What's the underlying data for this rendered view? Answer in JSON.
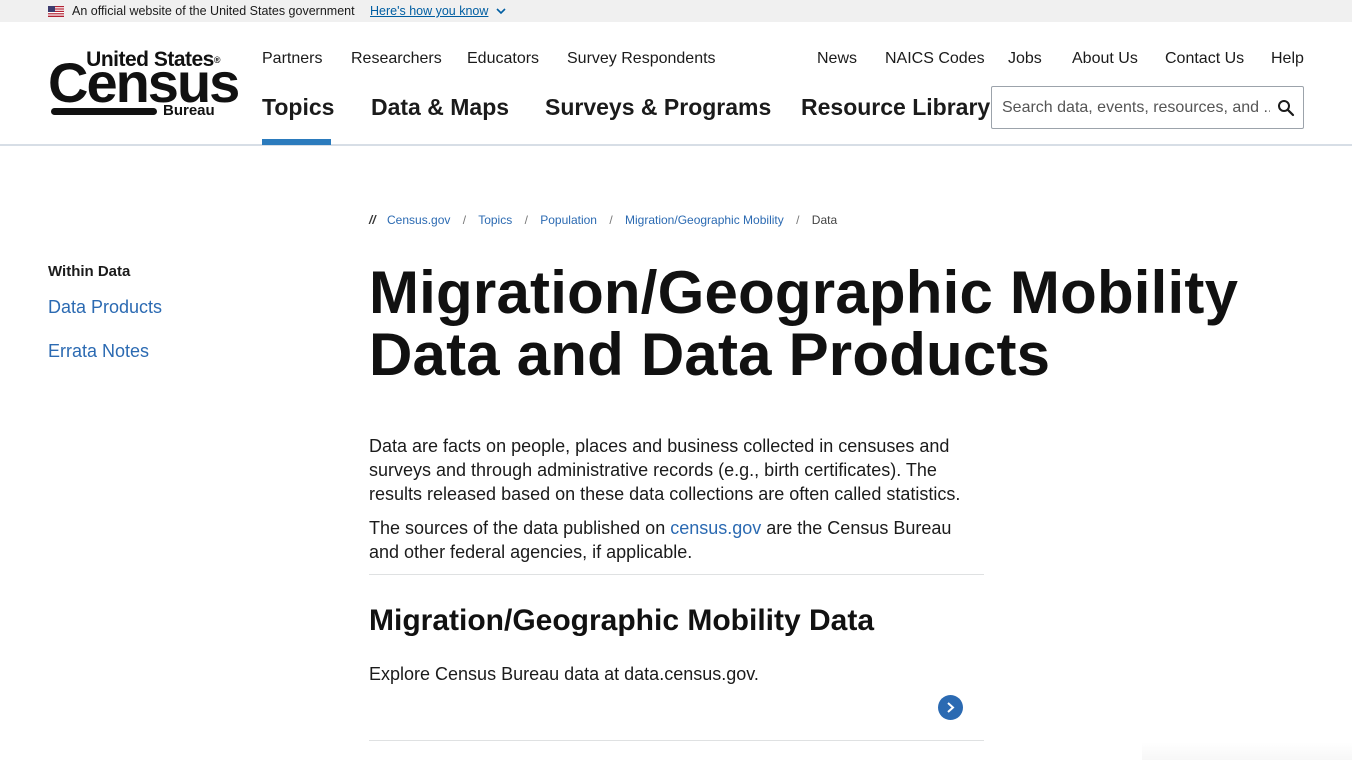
{
  "gov_banner": {
    "text": "An official website of the United States government",
    "link": "Here's how you know"
  },
  "logo": {
    "line1": "United States",
    "line2": "Census",
    "line3": "Bureau"
  },
  "utility_nav": [
    "Partners",
    "Researchers",
    "Educators",
    "Survey Respondents"
  ],
  "utility_nav_right": [
    "News",
    "NAICS Codes",
    "Jobs",
    "About Us",
    "Contact Us",
    "Help"
  ],
  "main_nav": [
    "Topics",
    "Data & Maps",
    "Surveys & Programs",
    "Resource Library"
  ],
  "search": {
    "placeholder": "Search data, events, resources, and ..."
  },
  "sidebar": {
    "title": "Within Data",
    "items": [
      "Data Products",
      "Errata Notes"
    ]
  },
  "breadcrumb": {
    "start": "//",
    "items": [
      "Census.gov",
      "Topics",
      "Population",
      "Migration/Geographic Mobility",
      "Data"
    ]
  },
  "page": {
    "title": "Migration/Geographic Mobility Data and Data Products",
    "intro": "Data are facts on people, places and business collected in censuses and surveys and through administrative records (e.g., birth certificates). The results released based on these data collections are often called statistics.",
    "sources_before": "The sources of the data published on ",
    "sources_link": "census.gov",
    "sources_after": " are the Census Bureau and other federal agencies, if applicable."
  },
  "section": {
    "title": "Migration/Geographic Mobility Data",
    "description": "Explore Census Bureau data at data.census.gov."
  },
  "colors": {
    "accent": "#2b7bbd",
    "link": "#2b6ab2",
    "banner_bg": "#f0f0f0"
  }
}
